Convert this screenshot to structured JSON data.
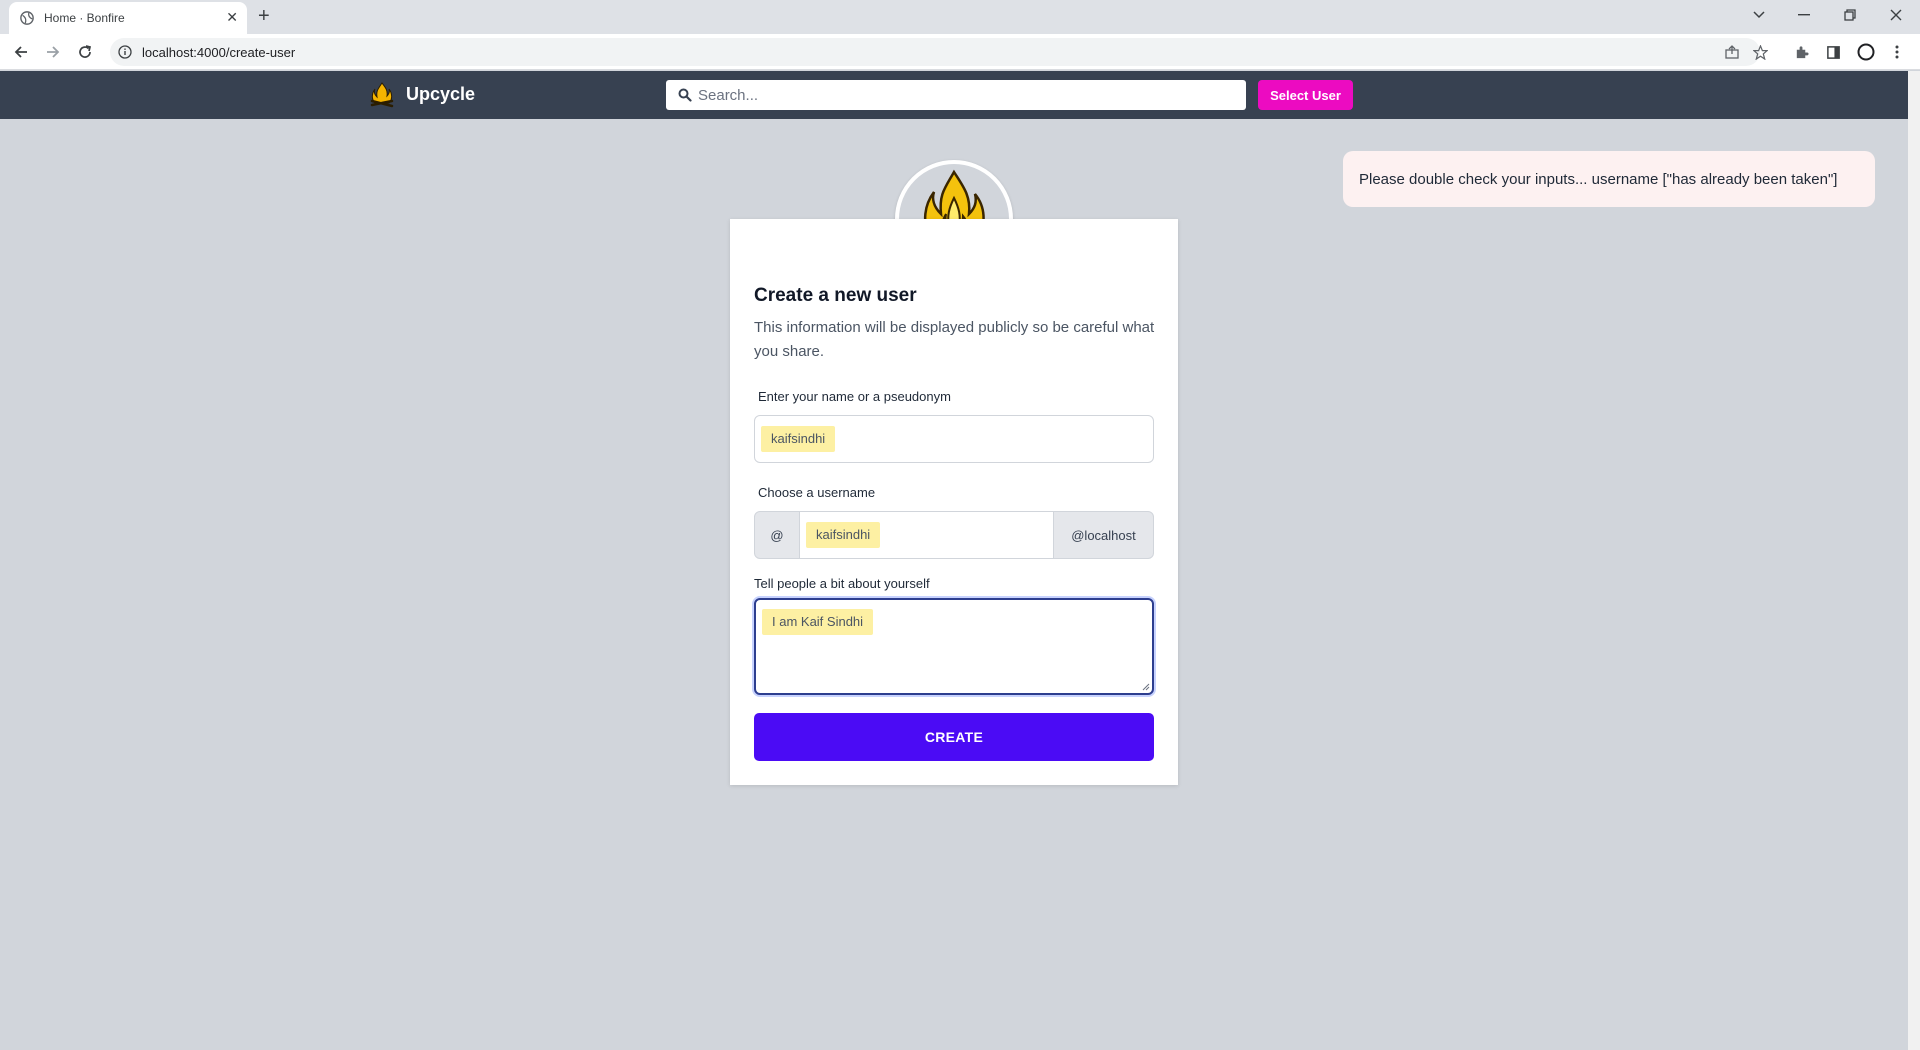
{
  "browser": {
    "tab_title": "Home · Bonfire",
    "url": "localhost:4000/create-user"
  },
  "app": {
    "brand": "Upcycle",
    "search_placeholder": "Search...",
    "select_user_label": "Select User"
  },
  "flash": {
    "message": "Please double check your inputs... username [\"has already been taken\"]"
  },
  "form": {
    "title": "Create a new user",
    "description": "This information will be displayed publicly so be careful what you share.",
    "name_label": "Enter your name or a pseudonym",
    "name_value": "kaifsindhi",
    "username_label": "Choose a username",
    "username_prefix": "@",
    "username_value": "kaifsindhi",
    "username_suffix": "@localhost",
    "bio_label": "Tell people a bit about yourself",
    "bio_value": "I am Kaif Sindhi",
    "submit_label": "CREATE"
  },
  "colors": {
    "header_bg": "#374151",
    "select_user_bg": "#ec0bc1",
    "create_bg": "#4b0bf5",
    "highlight": "#fdf0a3",
    "page_bg": "#d1d5db"
  }
}
